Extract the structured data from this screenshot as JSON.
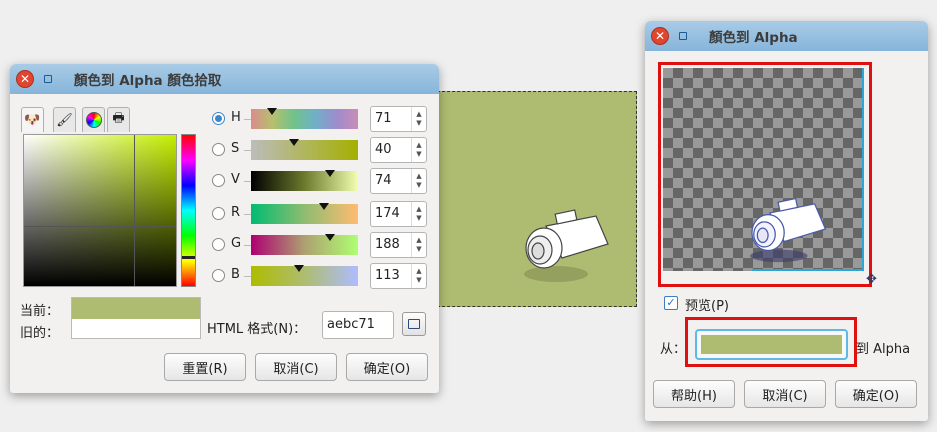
{
  "colors": {
    "accent": "#aebc71",
    "highlight": "#e01010",
    "titlebar": "#86b5da"
  },
  "color_picker": {
    "title": "顏色到 Alpha 顏色拾取",
    "tabs": [
      "gimp-icon",
      "brush-icon",
      "color-wheel-icon",
      "printer-icon"
    ],
    "channels": [
      {
        "label": "H",
        "value": "71",
        "selected": true
      },
      {
        "label": "S",
        "value": "40",
        "selected": false
      },
      {
        "label": "V",
        "value": "74",
        "selected": false
      },
      {
        "label": "R",
        "value": "174",
        "selected": false
      },
      {
        "label": "G",
        "value": "188",
        "selected": false
      },
      {
        "label": "B",
        "value": "113",
        "selected": false
      }
    ],
    "current_label": "当前：",
    "old_label": "旧的：",
    "html_label": "HTML 格式(N)：",
    "html_value": "aebc71",
    "buttons": {
      "reset": "重置(R)",
      "cancel": "取消(C)",
      "ok": "确定(O)"
    }
  },
  "color_to_alpha": {
    "title": "顏色到 Alpha",
    "preview_label": "预览(P)",
    "preview_checked": true,
    "from_label": "从：",
    "to_label": "到 Alpha",
    "buttons": {
      "help": "帮助(H)",
      "cancel": "取消(C)",
      "ok": "确定(O)"
    }
  }
}
